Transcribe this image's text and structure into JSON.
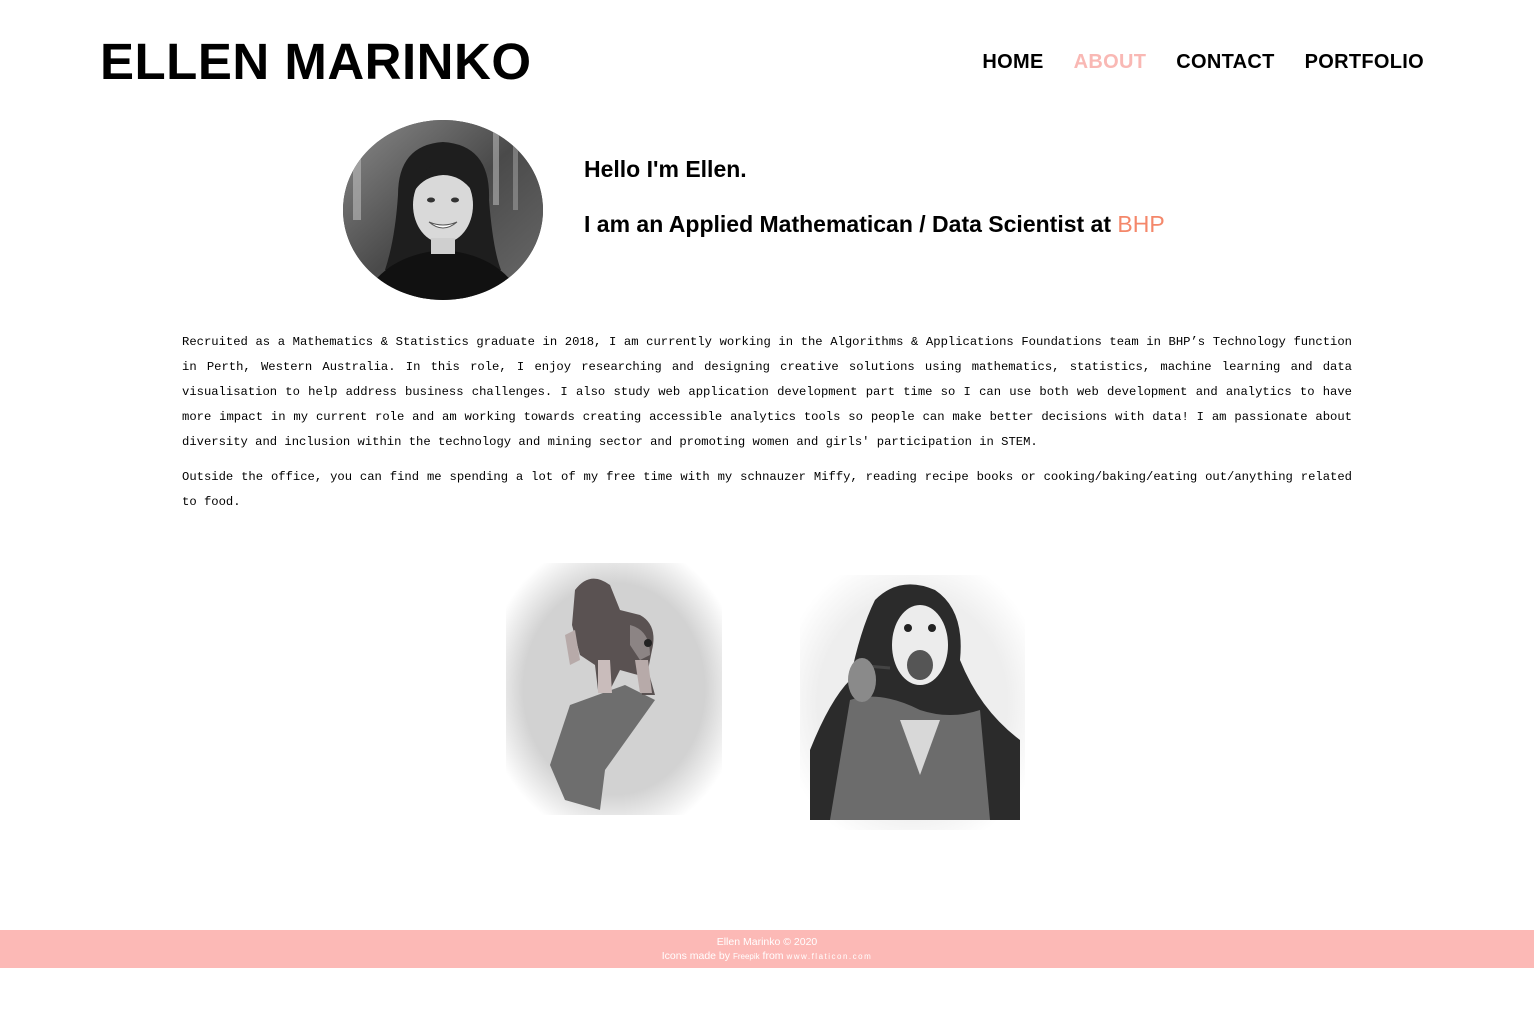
{
  "header": {
    "title": "ELLEN MARINKO",
    "nav": [
      {
        "label": "HOME",
        "active": false
      },
      {
        "label": "ABOUT",
        "active": true
      },
      {
        "label": "CONTACT",
        "active": false
      },
      {
        "label": "PORTFOLIO",
        "active": false
      }
    ]
  },
  "intro": {
    "greeting": "Hello I'm Ellen.",
    "role_prefix": "I am an Applied Mathematican / Data Scientist at ",
    "company": "BHP"
  },
  "bio": {
    "paragraph1": "Recruited as a Mathematics & Statistics graduate in 2018, I am currently working in the Algorithms & Applications Foundations team in BHP’s Technology function in Perth, Western Australia. In this role, I enjoy researching and designing creative solutions using mathematics, statistics, machine learning and data visualisation to help address business challenges. I also study web application development part time so I can use both web development and analytics to have more impact in my current role and am working towards creating accessible analytics tools so people can make better decisions with data! I am passionate about diversity and inclusion within the technology and mining sector and promoting women and girls' participation in STEM.",
    "paragraph2": "Outside the office, you can find me spending a lot of my free time with my schnauzer Miffy, reading recipe books or cooking/baking/eating out/anything related to food."
  },
  "footer": {
    "copyright": "Ellen Marinko © 2020",
    "icons_prefix": "Icons made by ",
    "icons_author": "Freepik",
    "icons_from": " from ",
    "icons_site": "www.flaticon.com"
  },
  "colors": {
    "accent": "#f9b8b4",
    "company": "#f4876a",
    "footer_bg": "#fcb9b6"
  }
}
